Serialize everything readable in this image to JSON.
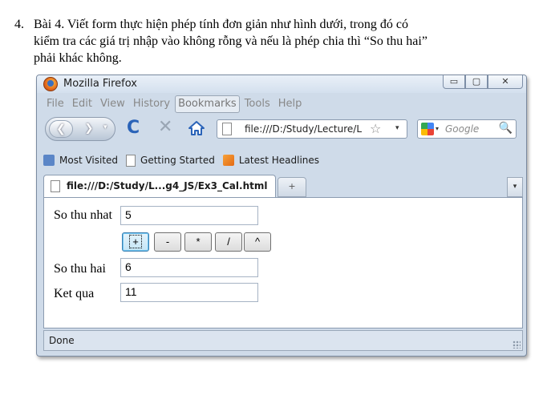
{
  "document": {
    "item_number": "4.",
    "line1": "Bài 4. Viết form thực hiện phép tính đơn giản như hình dưới, trong đó có",
    "line2": "kiểm tra các giá trị nhập vào không rỗng và nếu là phép chia thì “So thu hai”",
    "line3": "phải khác không."
  },
  "window": {
    "title": "Mozilla Firefox",
    "buttons": {
      "minimize": "▭",
      "maximize": "▢",
      "close": "✕"
    }
  },
  "menubar": {
    "items": [
      "File",
      "Edit",
      "View",
      "History",
      "Bookmarks",
      "Tools",
      "Help"
    ],
    "active": "Bookmarks"
  },
  "navbar": {
    "back": "❮",
    "forward": "❯",
    "history_dropdown": "▾",
    "reload": "C",
    "stop": "✕",
    "url": "file:///D:/Study/Lecture/L",
    "url_dropdown": "▾",
    "bookmark_star": "☆",
    "search_placeholder": "Google",
    "search_engine_dropdown": "▾",
    "search_button": "🔍"
  },
  "bookmarks_toolbar": {
    "items": [
      {
        "label": "Most Visited",
        "icon": "most-visited-icon"
      },
      {
        "label": "Getting Started",
        "icon": "page-icon"
      },
      {
        "label": "Latest Headlines",
        "icon": "rss-icon"
      }
    ]
  },
  "tabs": {
    "active_tab_label": "file:///D:/Study/L...g4_JS/Ex3_Cal.html",
    "new_tab": "+",
    "list_all_tabs": "▾"
  },
  "form": {
    "first_label": "So thu nhat",
    "first_value": "5",
    "operators": [
      "+",
      "-",
      "*",
      "/",
      "^"
    ],
    "focused_operator": "+",
    "second_label": "So thu hai",
    "second_value": "6",
    "result_label": "Ket qua",
    "result_value": "11"
  },
  "status": {
    "text": "Done"
  },
  "colors": {
    "accent": "#2a63b8",
    "chrome": "#cfdbe9",
    "focus_border": "#3c7fb1"
  }
}
